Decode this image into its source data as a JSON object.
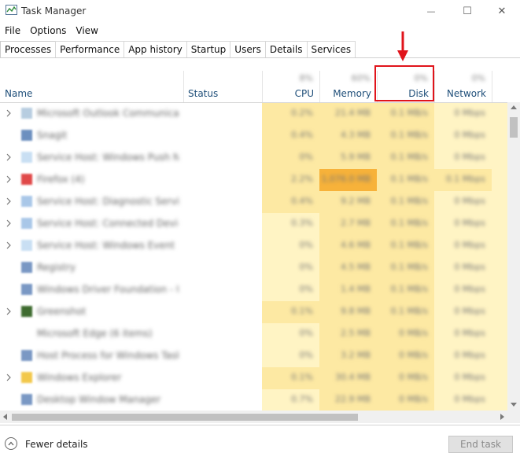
{
  "window": {
    "title": "Task Manager",
    "controls": {
      "minimize": "—",
      "maximize": "☐",
      "close": "✕"
    }
  },
  "menu": {
    "items": [
      "File",
      "Options",
      "View"
    ]
  },
  "tabs": [
    {
      "label": "Processes",
      "active": true
    },
    {
      "label": "Performance"
    },
    {
      "label": "App history"
    },
    {
      "label": "Startup"
    },
    {
      "label": "Users"
    },
    {
      "label": "Details"
    },
    {
      "label": "Services"
    }
  ],
  "columns": {
    "name": "Name",
    "status": "Status",
    "cpu": {
      "label": "CPU",
      "total": "8%"
    },
    "memory": {
      "label": "Memory",
      "total": "60%"
    },
    "disk": {
      "label": "Disk",
      "total": "0%"
    },
    "network": {
      "label": "Network",
      "total": "0%"
    }
  },
  "processes": [
    {
      "expandable": true,
      "icon_color": "#b7cde0",
      "name": "Microsoft Outlook Communications",
      "cpu": "0.2%",
      "memory": "21.4 MB",
      "disk": "0.1 MB/s",
      "network": "0 Mbps"
    },
    {
      "expandable": false,
      "icon_color": "#6c8fbf",
      "name": "Snagit",
      "cpu": "0.4%",
      "memory": "4.3 MB",
      "disk": "0.1 MB/s",
      "network": "0 Mbps"
    },
    {
      "expandable": true,
      "icon_color": "#c9dff3",
      "name": "Service Host: Windows Push No...",
      "cpu": "0%",
      "memory": "5.9 MB",
      "disk": "0.1 MB/s",
      "network": "0 Mbps"
    },
    {
      "expandable": true,
      "icon_color": "#e04848",
      "name": "Firefox (4)",
      "cpu": "2.2%",
      "memory": "1,076.0 MB",
      "disk": "0.1 MB/s",
      "network": "0.1 Mbps"
    },
    {
      "expandable": true,
      "icon_color": "#a9c7e8",
      "name": "Service Host: Diagnostic Service",
      "cpu": "0.4%",
      "memory": "9.2 MB",
      "disk": "0.1 MB/s",
      "network": "0 Mbps"
    },
    {
      "expandable": true,
      "icon_color": "#a9c7e8",
      "name": "Service Host: Connected Devic...",
      "cpu": "0.3%",
      "memory": "2.7 MB",
      "disk": "0.1 MB/s",
      "network": "0 Mbps"
    },
    {
      "expandable": true,
      "icon_color": "#c9dff3",
      "name": "Service Host: Windows Event Log",
      "cpu": "0%",
      "memory": "4.6 MB",
      "disk": "0.1 MB/s",
      "network": "0 Mbps"
    },
    {
      "expandable": false,
      "icon_color": "#7a98c4",
      "name": "Registry",
      "cpu": "0%",
      "memory": "4.5 MB",
      "disk": "0.1 MB/s",
      "network": "0 Mbps"
    },
    {
      "expandable": false,
      "icon_color": "#7a98c4",
      "name": "Windows Driver Foundation - U...",
      "cpu": "0%",
      "memory": "1.4 MB",
      "disk": "0.1 MB/s",
      "network": "0 Mbps"
    },
    {
      "expandable": true,
      "icon_color": "#3e6b2f",
      "name": "Greenshot",
      "cpu": "0.1%",
      "memory": "9.8 MB",
      "disk": "0.1 MB/s",
      "network": "0 Mbps"
    },
    {
      "expandable": false,
      "icon_color": "",
      "name": "Microsoft Edge (6 items)",
      "cpu": "0%",
      "memory": "2.5 MB",
      "disk": "0 MB/s",
      "network": "0 Mbps"
    },
    {
      "expandable": false,
      "icon_color": "#7a98c4",
      "name": "Host Process for Windows Tasks",
      "cpu": "0%",
      "memory": "3.2 MB",
      "disk": "0 MB/s",
      "network": "0 Mbps"
    },
    {
      "expandable": true,
      "icon_color": "#f2c84b",
      "name": "Windows Explorer",
      "cpu": "0.1%",
      "memory": "30.4 MB",
      "disk": "0 MB/s",
      "network": "0 Mbps"
    },
    {
      "expandable": false,
      "icon_color": "#7a98c4",
      "name": "Desktop Window Manager",
      "cpu": "0.7%",
      "memory": "22.9 MB",
      "disk": "0 MB/s",
      "network": "0 Mbps"
    }
  ],
  "footer": {
    "fewer_details": "Fewer details",
    "end_task": "End task"
  },
  "colors": {
    "heat_low": "#fff4c4",
    "heat_mid": "#fde9a3",
    "heat_high": "#f9cf62",
    "heat_hot": "#f7b23a",
    "annotation": "#e0141b",
    "header_text": "#1e4e79"
  }
}
